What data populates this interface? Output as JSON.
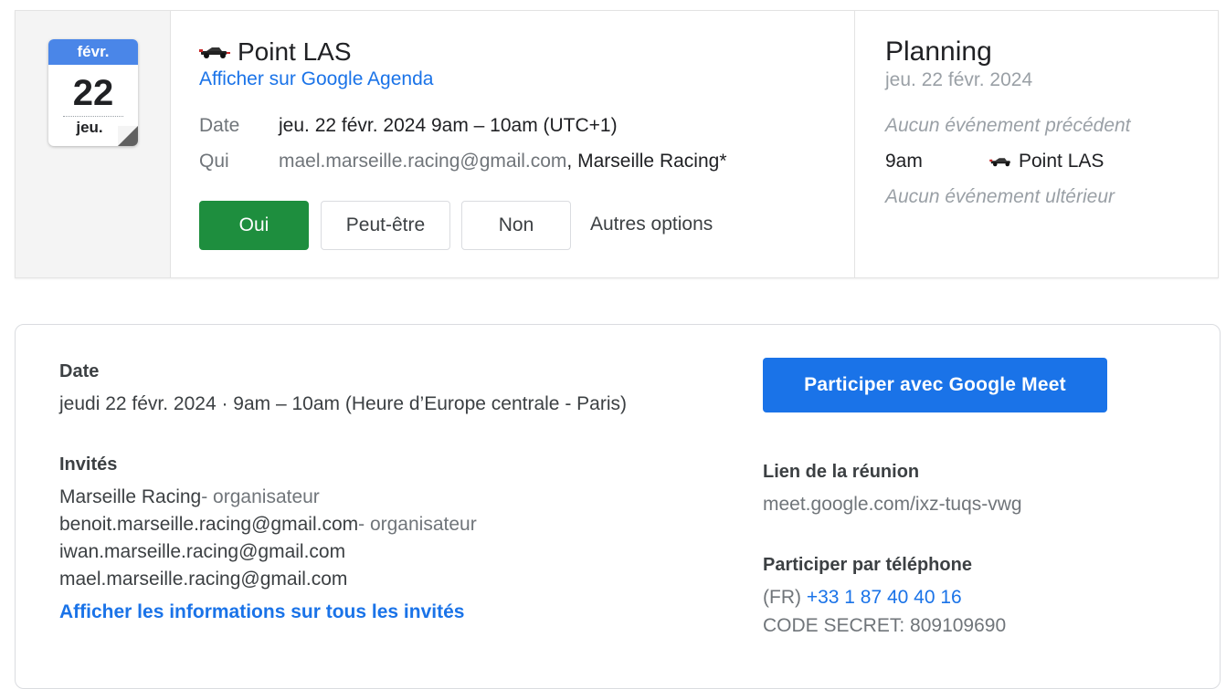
{
  "calendar_icon": {
    "month": "févr.",
    "day": "22",
    "weekday": "jeu."
  },
  "event": {
    "title": "Point LAS",
    "view_link": "Afficher sur Google Agenda",
    "date_label": "Date",
    "date_value": "jeu. 22 févr. 2024 9am – 10am (UTC+1)",
    "who_label": "Qui",
    "who_guest": "mael.marseille.racing@gmail.com",
    "who_sep": ", ",
    "who_organizer": "Marseille Racing*"
  },
  "rsvp": {
    "yes": "Oui",
    "maybe": "Peut-être",
    "no": "Non",
    "more": "Autres options"
  },
  "agenda": {
    "title": "Planning",
    "date": "jeu. 22 févr. 2024",
    "previous": "Aucun événement précédent",
    "item_time": "9am",
    "item_title": "Point LAS",
    "next": "Aucun événement ultérieur"
  },
  "details": {
    "date_heading": "Date",
    "date_text": "jeudi 22 févr. 2024 · 9am – 10am (Heure d’Europe centrale - Paris)",
    "guests_heading": "Invités",
    "guests": [
      {
        "name": "Marseille Racing",
        "role": "- organisateur"
      },
      {
        "name": "benoit.marseille.racing@gmail.com",
        "role": "- organisateur"
      },
      {
        "name": "iwan.marseille.racing@gmail.com",
        "role": ""
      },
      {
        "name": "mael.marseille.racing@gmail.com",
        "role": ""
      }
    ],
    "all_guests_link": "Afficher les informations sur tous les invités",
    "meet_button": "Participer avec Google Meet",
    "meeting_link_heading": "Lien de la réunion",
    "meeting_link": "meet.google.com/ixz-tuqs-vwg",
    "phone_heading": "Participer par téléphone",
    "phone_country": "(FR) ",
    "phone_number": "+33 1 87 40 40 16",
    "pin": "CODE SECRET: 809109690"
  },
  "colors": {
    "accent_blue": "#1a73e8",
    "yes_green": "#1e8e3e",
    "calendar_blue": "#4a86e8"
  },
  "icons": [
    "race-car-icon",
    "calendar-date-icon"
  ]
}
